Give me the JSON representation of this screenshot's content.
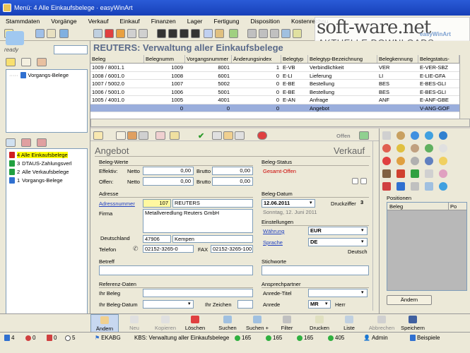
{
  "window": {
    "title": "Menü: 4  Alle Einkaufsbelege  ·  easyWinArt"
  },
  "menu": [
    "Stammdaten",
    "Vorgänge",
    "Verkauf",
    "Einkauf",
    "Finanzen",
    "Lager",
    "Fertigung",
    "Disposition",
    "Kostenrechnu"
  ],
  "watermark": {
    "line1": "soft-ware.net",
    "line2": "AKTUELLE DOWNLOADS",
    "brand": "easyWinArt"
  },
  "left": {
    "ready": "ready",
    "tree_top": [
      "Vorgangs-Belege"
    ],
    "tree_bottom": [
      {
        "num": "4",
        "label": "Alle Einkaufsbelege",
        "color": "#d02020",
        "highlight": true
      },
      {
        "num": "3",
        "label": "DTAUS-Zahlungsverl",
        "color": "#20a040",
        "highlight": false
      },
      {
        "num": "2",
        "label": "Alle Verkaufsbelege",
        "color": "#20a040",
        "highlight": false
      },
      {
        "num": "1",
        "label": "Vorgangs-Belege",
        "color": "#3070d0",
        "highlight": false
      }
    ]
  },
  "page_title": "REUTERS:  Verwaltung aller Einkaufsbelege",
  "grid": {
    "columns": [
      "Beleg",
      "Belegnumm",
      "Vorgangsnummer",
      "Änderungsindex",
      "Belegtyp",
      "Belegtyp-Bezeichnung",
      "Belegkennung",
      "Belegstatus-"
    ],
    "rows": [
      [
        "1009 / 8001.1",
        "1009",
        "8001",
        "1",
        "E-VB",
        "Verbindlichkeit",
        "VER",
        "E-VER-SBZ"
      ],
      [
        "1008 / 6001.0",
        "1008",
        "6001",
        "0",
        "E-LI",
        "Lieferung",
        "LI",
        "E-LIE-GFA"
      ],
      [
        "1007 / 5002.0",
        "1007",
        "5002",
        "0",
        "E-BE",
        "Bestellung",
        "BES",
        "E-BES-GLI"
      ],
      [
        "1006 / 5001.0",
        "1006",
        "5001",
        "0",
        "E-BE",
        "Bestellung",
        "BES",
        "E-BES-GLI"
      ],
      [
        "1005 / 4001.0",
        "1005",
        "4001",
        "0",
        "E-AN",
        "Anfrage",
        "ANF",
        "E-ANF-GBE"
      ],
      [
        "",
        "0",
        "0",
        "0",
        "",
        "Angebot",
        "",
        "V-ANG-GOF"
      ]
    ]
  },
  "detail": {
    "offen": "Offen",
    "doc_title": "Angebot",
    "doc_type": "Verkauf",
    "belegwerte": "Beleg-Werte",
    "effektiv": "Effektiv:",
    "offen_lbl": "Offen:",
    "netto": "Netto",
    "brutto": "Brutto",
    "v_eff_netto": "0,00",
    "v_eff_brutto": "0,00",
    "v_off_netto": "0,00",
    "v_off_brutto": "0,00",
    "adresse": "Adresse",
    "adressnummer_lbl": "Adressnummer",
    "adressnummer": "107",
    "adress_name": "REUTERS",
    "firma_lbl": "Firma",
    "firma": "Metallveredlung Reuters GmbH",
    "land": "Deutschland",
    "plz": "47906",
    "ort": "Kempen",
    "telefon_lbl": "Telefon",
    "telefon": "02152-3265-0",
    "fax_lbl": "FAX",
    "fax": "02152-3265-100",
    "betreff": "Betreff",
    "referenz": "Referenz-Daten",
    "ihr_beleg": "Ihr Beleg",
    "ihr_beleg_datum": "Ihr Beleg-Datum",
    "ihr_zeichen": "Ihr Zeichen",
    "belegstatus": "Beleg-Status",
    "status_value": "Gesamt-Offen",
    "belegdatum": "Beleg-Datum",
    "datum": "12.06.2011",
    "datum_text": "Sonntag, 12. Juni 2011",
    "druckziffer_lbl": "Druckziffer",
    "druckziffer": "3",
    "einstellungen": "Einstellungen",
    "waehrung_lbl": "Währung",
    "waehrung": "EUR",
    "sprache_lbl": "Sprache",
    "sprache": "DE",
    "sprache_text": "Deutsch",
    "stichworte": "Stichworte",
    "ansprechpartner": "Ansprechpartner",
    "anrede_titel": "Anrede-Titel",
    "anrede_lbl": "Anrede",
    "anrede": "MR",
    "herr": "Herr"
  },
  "right": {
    "positionen": "Positionen",
    "col_beleg": "Beleg",
    "col_pos": "Po",
    "aendern": "Ändern"
  },
  "buttons": [
    "Ändern",
    "Neu",
    "Kopieren",
    "Löschen",
    "Suchen",
    "Suchen +",
    "Filter",
    "Drucken",
    "Liste",
    "Abbrechen",
    "Speichern"
  ],
  "status": {
    "c1": "4",
    "c2": "0",
    "c3": "0",
    "c4": "5",
    "ekabg": "EKABG",
    "kbs": "KBS: Verwaltung aller Einkaufsbelege",
    "n1": "165",
    "n2": "165",
    "n3": "165",
    "n4": "405",
    "user": "Admin",
    "mode": "Beispiele"
  },
  "colors": {
    "accent": "#2a5bd7",
    "selection": "#9aaedc",
    "highlight": "#ffff00",
    "status_red": "#c00000"
  }
}
